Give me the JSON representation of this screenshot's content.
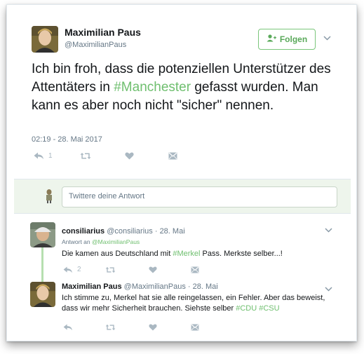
{
  "main_tweet": {
    "author_name": "Maximilian Paus",
    "author_handle": "@MaximilianPaus",
    "follow_label": "Folgen",
    "text_before": "Ich bin froh, dass die potenziellen Unterstützer des Attentäters in ",
    "hashtag": "#Manchester",
    "text_after": " gefasst wurden. Man kann es aber noch nicht \"sicher\" nennen.",
    "timestamp": "02:19 - 28. Mai 2017",
    "reply_count": "1"
  },
  "reply_box": {
    "placeholder": "Twittere deine Antwort"
  },
  "replies": [
    {
      "author_name": "consiliarius",
      "author_handle": "@consiliarius",
      "date": "· 28. Mai",
      "reply_to_label": "Antwort an",
      "reply_to_handle": "@MaximilianPaus",
      "text_before": "Die kamen aus Deutschland mit ",
      "hashtag": "#Merkel",
      "text_after": " Pass. Merkste selber...!",
      "reply_count": "2"
    },
    {
      "author_name": "Maximilian Paus",
      "author_handle": "@MaximilianPaus",
      "date": "· 28. Mai",
      "text_before": "Ich stimme zu, Merkel hat sie alle reingelassen, ein Fehler. Aber das beweist, dass wir mehr Sicherheit brauchen. Siehste selber ",
      "hashtag1": "#CDU",
      "hashtag2": "#CSU"
    }
  ],
  "colors": {
    "accent_green": "#6fbf6f",
    "icon_gray": "#aab8c2",
    "reply_bar_bg": "#eef5ec"
  },
  "icons": [
    "add-user-icon",
    "chevron-down-icon",
    "reply-icon",
    "retweet-icon",
    "heart-icon",
    "direct-message-icon"
  ]
}
